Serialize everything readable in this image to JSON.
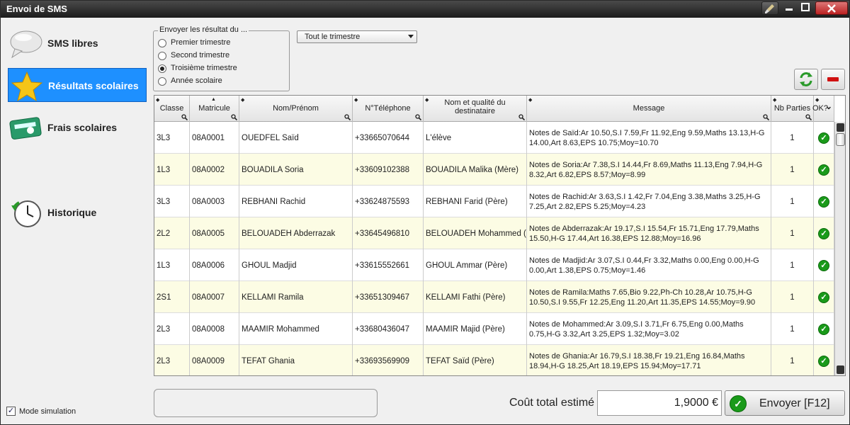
{
  "window": {
    "title": "Envoi de SMS"
  },
  "sidebar": {
    "items": [
      {
        "label": "SMS libres",
        "icon": "speech-bubble-icon"
      },
      {
        "label": "Résultats scolaires",
        "icon": "star-icon"
      },
      {
        "label": "Frais scolaires",
        "icon": "card-icon"
      },
      {
        "label": "Historique",
        "icon": "clock-icon"
      }
    ],
    "mode_simulation": "Mode simulation"
  },
  "period": {
    "legend": "Envoyer les résultat du ...",
    "options": [
      "Premier trimestre",
      "Second trimestre",
      "Troisième trimestre",
      "Année scolaire"
    ],
    "selected": "Troisième trimestre"
  },
  "combo": {
    "value": "Tout le trimestre"
  },
  "grid": {
    "headers": {
      "classe": "Classe",
      "matricule": "Matricule",
      "nom": "Nom/Prénom",
      "tel": "N°Téléphone",
      "dest": "Nom et qualité du destinataire",
      "message": "Message",
      "parties": "Nb Parties",
      "ok": "OK?"
    },
    "rows": [
      {
        "classe": "3L3",
        "matricule": "08A0001",
        "nom": "OUEDFEL Saïd",
        "tel": "+33665070644",
        "dest": "L'élève",
        "message": "Notes de Saïd:Ar 10.50,S.I 7.59,Fr 11.92,Eng 9.59,Maths 13.13,H-G 14.00,Art 8.63,EPS 10.75;Moy=10.70",
        "parties": "1"
      },
      {
        "classe": "1L3",
        "matricule": "08A0002",
        "nom": "BOUADILA Soria",
        "tel": "+33609102388",
        "dest": "BOUADILA Malika (Mère)",
        "message": "Notes de Soria:Ar 7.38,S.I 14.44,Fr 8.69,Maths 11.13,Eng 7.94,H-G 8.32,Art 6.82,EPS 8.57;Moy=8.99",
        "parties": "1"
      },
      {
        "classe": "3L3",
        "matricule": "08A0003",
        "nom": "REBHANI Rachid",
        "tel": "+33624875593",
        "dest": "REBHANI Farid (Père)",
        "message": "Notes de Rachid:Ar 3.63,S.I 1.42,Fr 7.04,Eng 3.38,Maths 3.25,H-G 7.25,Art 2.82,EPS 5.25;Moy=4.23",
        "parties": "1"
      },
      {
        "classe": "2L2",
        "matricule": "08A0005",
        "nom": "BELOUADEH Abderrazak",
        "tel": "+33645496810",
        "dest": "BELOUADEH Mohammed (Tu",
        "message": "Notes de Abderrazak:Ar 19.17,S.I 15.54,Fr 15.71,Eng 17.79,Maths 15.50,H-G 17.44,Art 16.38,EPS 12.88;Moy=16.96",
        "parties": "1"
      },
      {
        "classe": "1L3",
        "matricule": "08A0006",
        "nom": "GHOUL Madjid",
        "tel": "+33615552661",
        "dest": "GHOUL Ammar (Père)",
        "message": "Notes de Madjid:Ar 3.07,S.I 0.44,Fr 3.32,Maths 0.00,Eng 0.00,H-G 0.00,Art 1.38,EPS 0.75;Moy=1.46",
        "parties": "1"
      },
      {
        "classe": "2S1",
        "matricule": "08A0007",
        "nom": "KELLAMI Ramila",
        "tel": "+33651309467",
        "dest": "KELLAMI Fathi (Père)",
        "message": "Notes de Ramila:Maths 7.65,Bio 9.22,Ph-Ch 10.28,Ar 10.75,H-G 10.50,S.I 9.55,Fr 12.25,Eng 11.20,Art 11.35,EPS 14.55;Moy=9.90",
        "parties": "1"
      },
      {
        "classe": "2L3",
        "matricule": "08A0008",
        "nom": "MAAMIR Mohammed",
        "tel": "+33680436047",
        "dest": "MAAMIR Majid (Père)",
        "message": "Notes de Mohammed:Ar 3.09,S.I 3.71,Fr 6.75,Eng 0.00,Maths 0.75,H-G 3.32,Art 3.25,EPS 1.32;Moy=3.02",
        "parties": "1"
      },
      {
        "classe": "2L3",
        "matricule": "08A0009",
        "nom": "TEFAT Ghania",
        "tel": "+33693569909",
        "dest": "TEFAT Saïd (Père)",
        "message": "Notes de Ghania:Ar 16.79,S.I 18.38,Fr 19.21,Eng 16.84,Maths 18.94,H-G 18.25,Art 18.19,EPS 15.94;Moy=17.71",
        "parties": "1"
      }
    ]
  },
  "footer": {
    "cost_label": "Coût total estimé",
    "cost_value": "1,9000 €",
    "send_label": "Envoyer [F12]"
  },
  "colors": {
    "accent": "#1e90ff",
    "ok_green": "#1a9a1a",
    "alt_row": "#fcfce4"
  }
}
